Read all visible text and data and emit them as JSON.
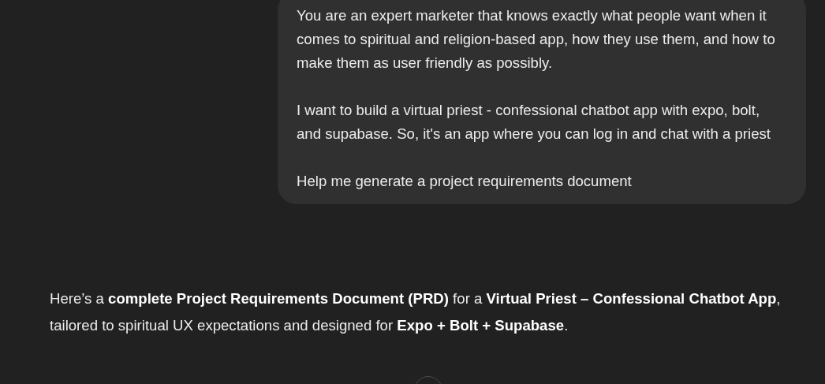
{
  "user_message": {
    "paragraphs": [
      "You are an expert marketer that knows exactly what people want when it comes to spiritual and religion-based app, how they use them, and how to make them as user friendly as possibly.",
      "I want to build a virtual priest - confessional chatbot app with expo, bolt, and supabase. So, it's an app where you can log in and chat with a priest",
      "Help me generate a project requirements document"
    ]
  },
  "assistant_message": {
    "paragraphs": [
      "Here’s a **complete Project Requirements Document (PRD)** for a **Virtual Priest – Confessional Chatbot App**, tailored to spiritual UX expectations and designed for **Expo + Bolt + Supabase**."
    ]
  }
}
